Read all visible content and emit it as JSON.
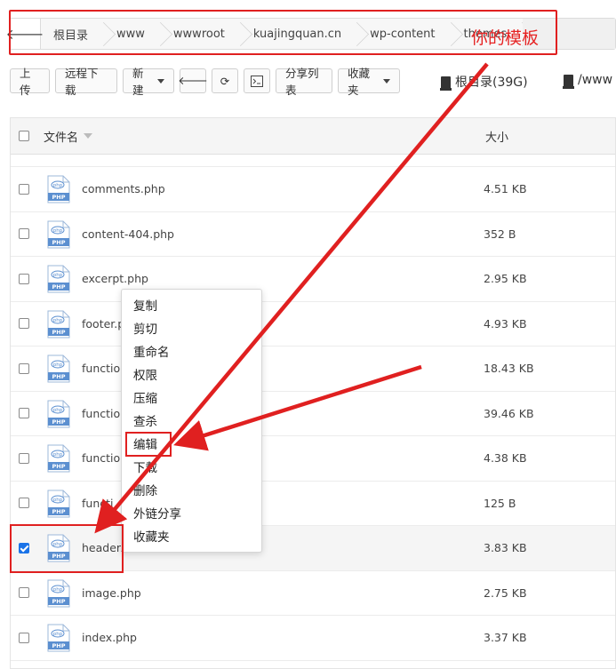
{
  "breadcrumb": {
    "items": [
      "根目录",
      "www",
      "wwwroot",
      "kuajingquan.cn",
      "wp-content",
      "themes",
      ""
    ]
  },
  "annotation": {
    "label": "你的模板",
    "color": "#e02020"
  },
  "toolbar": {
    "upload": "上传",
    "remote_download": "远程下载",
    "new": "新建",
    "share_list": "分享列表",
    "favorites": "收藏夹"
  },
  "disks": [
    {
      "label": "根目录(39G)"
    },
    {
      "label": "/www"
    }
  ],
  "table": {
    "headers": {
      "name": "文件名",
      "size": "大小"
    },
    "rows": [
      {
        "name": "comments.php",
        "size": "4.51 KB",
        "checked": false
      },
      {
        "name": "content-404.php",
        "size": "352 B",
        "checked": false
      },
      {
        "name": "excerpt.php",
        "size": "2.95 KB",
        "checked": false
      },
      {
        "name": "footer.p",
        "size": "4.93 KB",
        "checked": false
      },
      {
        "name": "function",
        "size": "18.43 KB",
        "checked": false
      },
      {
        "name": "function",
        "size": "39.46 KB",
        "checked": false
      },
      {
        "name": "function",
        "size": "4.38 KB",
        "checked": false
      },
      {
        "name": "functi",
        "size": "125 B",
        "checked": false
      },
      {
        "name": "header.",
        "size": "3.83 KB",
        "checked": true
      },
      {
        "name": "image.php",
        "size": "2.75 KB",
        "checked": false
      },
      {
        "name": "index.php",
        "size": "3.37 KB",
        "checked": false
      }
    ]
  },
  "file_icon_text": {
    "top": "php",
    "bottom": "PHP"
  },
  "context_menu": {
    "items": [
      "复制",
      "剪切",
      "重命名",
      "权限",
      "压缩",
      "查杀",
      "编辑",
      "下载",
      "删除",
      "外链分享",
      "收藏夹"
    ],
    "highlighted": "编辑"
  },
  "colors": {
    "accent": "#1a73e8",
    "annotation": "#e02020",
    "icon_blue": "#5b8fd0"
  }
}
